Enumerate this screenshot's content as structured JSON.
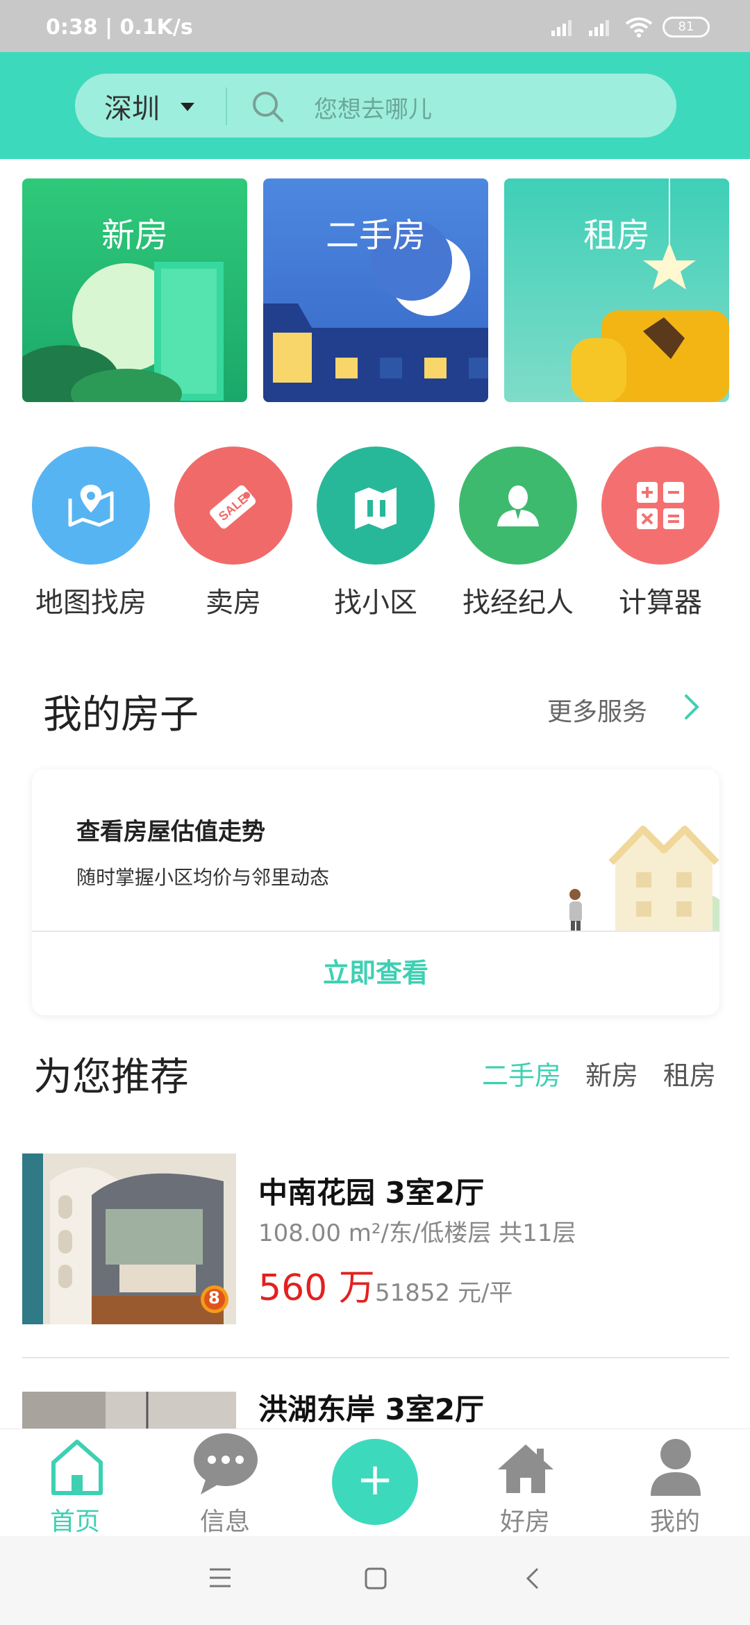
{
  "status_bar": {
    "time": "0:38 | 0.1K/s",
    "battery": "81"
  },
  "search": {
    "city": "深圳",
    "placeholder": "您想去哪儿"
  },
  "categories": [
    {
      "label": "新房"
    },
    {
      "label": "二手房"
    },
    {
      "label": "租房"
    }
  ],
  "quick_actions": [
    {
      "label": "地图找房",
      "icon": "map-pin-icon",
      "color": "#56b4f3"
    },
    {
      "label": "卖房",
      "icon": "sale-tag-icon",
      "color": "#f06a6a"
    },
    {
      "label": "找小区",
      "icon": "community-icon",
      "color": "#27b899"
    },
    {
      "label": "找经纪人",
      "icon": "agent-icon",
      "color": "#3dba6e"
    },
    {
      "label": "计算器",
      "icon": "calculator-icon",
      "color": "#f47070"
    }
  ],
  "my_house": {
    "title": "我的房子",
    "more": "更多服务",
    "card_title": "查看房屋估值走势",
    "card_subtitle": "随时掌握小区均价与邻里动态",
    "card_button": "立即查看"
  },
  "recommend": {
    "title": "为您推荐",
    "tabs": [
      {
        "label": "二手房",
        "active": true
      },
      {
        "label": "新房",
        "active": false
      },
      {
        "label": "租房",
        "active": false
      }
    ]
  },
  "listings": [
    {
      "title": "中南花园 3室2厅",
      "meta": "108.00 m²/东/低楼层 共11层",
      "price": "560 万",
      "unit_price": "51852 元/平",
      "badge": "8"
    },
    {
      "title": "洪湖东岸 3室2厅"
    }
  ],
  "bottom_nav": [
    {
      "label": "首页",
      "icon": "home-icon",
      "active": true
    },
    {
      "label": "信息",
      "icon": "chat-icon",
      "active": false
    },
    {
      "label": "",
      "icon": "plus-icon",
      "active": false
    },
    {
      "label": "好房",
      "icon": "house-icon",
      "active": false
    },
    {
      "label": "我的",
      "icon": "user-icon",
      "active": false
    }
  ],
  "colors": {
    "accent": "#3dd9bd",
    "price": "#e32020"
  }
}
